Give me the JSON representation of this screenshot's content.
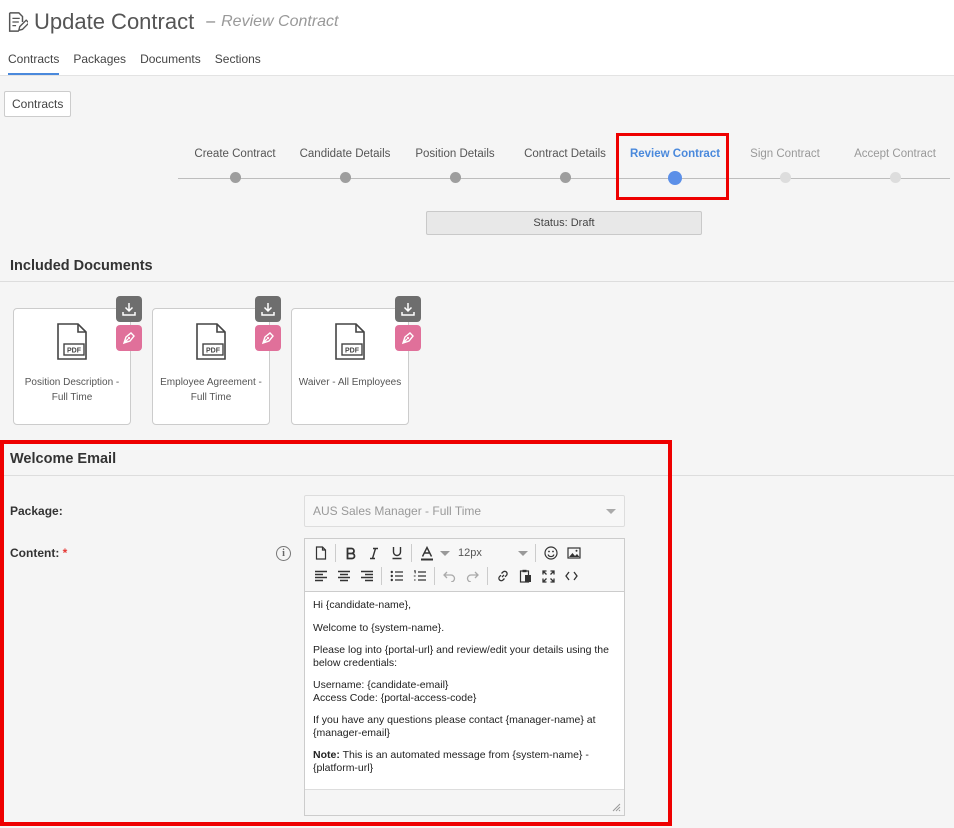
{
  "header": {
    "title": "Update Contract",
    "separator": "–",
    "subtitle": "Review Contract",
    "tabs": [
      {
        "label": "Contracts"
      },
      {
        "label": "Packages"
      },
      {
        "label": "Documents"
      },
      {
        "label": "Sections"
      }
    ]
  },
  "breadcrumb_button": "Contracts",
  "steps": [
    {
      "label": "Create Contract",
      "state": "done"
    },
    {
      "label": "Candidate Details",
      "state": "done"
    },
    {
      "label": "Position Details",
      "state": "done"
    },
    {
      "label": "Contract Details",
      "state": "done"
    },
    {
      "label": "Review Contract",
      "state": "current"
    },
    {
      "label": "Sign Contract",
      "state": "future"
    },
    {
      "label": "Accept Contract",
      "state": "future"
    }
  ],
  "status": "Status: Draft",
  "included_documents": {
    "title": "Included Documents",
    "items": [
      {
        "name": "Position Description - Full Time",
        "icon": "pdf-file-icon"
      },
      {
        "name": "Employee Agreement - Full Time",
        "icon": "pdf-file-icon"
      },
      {
        "name": "Waiver - All Employees",
        "icon": "pdf-file-icon"
      }
    ],
    "pdf_badge": "PDF"
  },
  "welcome_email": {
    "title": "Welcome Email",
    "package_label": "Package:",
    "package_value": "AUS Sales Manager - Full Time",
    "content_label": "Content:",
    "required_mark": "*",
    "info_glyph": "i",
    "font_size": "12px",
    "body": {
      "p1": "Hi {candidate-name},",
      "p2": "Welcome to {system-name}.",
      "p3": "Please log into {portal-url} and review/edit your details using the below credentials:",
      "p4a": "Username: {candidate-email}",
      "p4b": "Access Code: {portal-access-code}",
      "p5": "If you have any questions please contact {manager-name} at {manager-email}",
      "note_label": "Note:",
      "note_text": " This is an automated message from {system-name} - {platform-url}"
    }
  },
  "colors": {
    "accent": "#4a89dc",
    "highlight": "#ee0000",
    "download_button": "#6e6e6e",
    "sign_button": "#e0709a"
  }
}
